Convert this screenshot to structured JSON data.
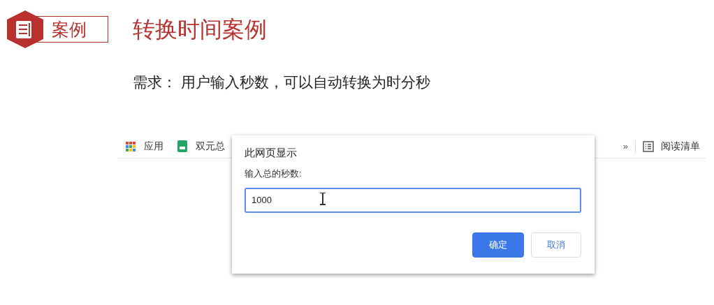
{
  "slide": {
    "badge": "案例",
    "title": "转换时间案例",
    "requirement": "需求： 用户输入秒数，可以自动转换为时分秒"
  },
  "bookmarks_bar": {
    "items": [
      {
        "kind": "apps",
        "label": "应用"
      },
      {
        "kind": "sheet",
        "label": "双元总"
      }
    ],
    "overflow": "»",
    "reading_list": "阅读清单"
  },
  "dialog": {
    "title": "此网页显示",
    "message": "输入总的秒数:",
    "value": "1000",
    "buttons": [
      {
        "label": "确定",
        "kind": "primary"
      },
      {
        "label": "取消",
        "kind": "secondary"
      }
    ]
  }
}
